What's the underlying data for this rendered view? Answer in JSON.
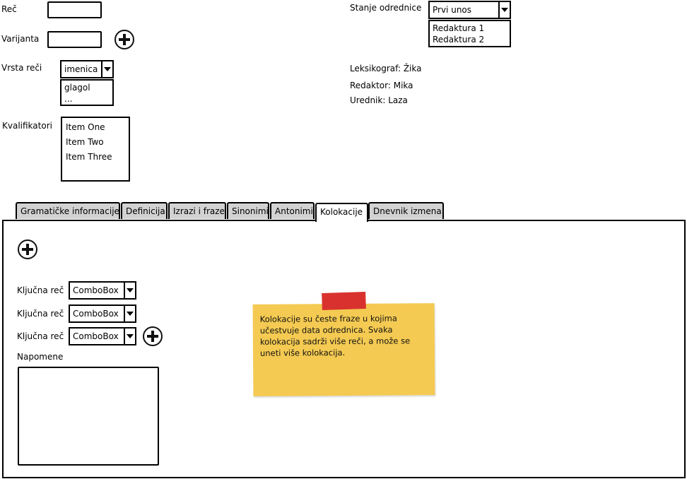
{
  "form": {
    "rec_label": "Reč",
    "varijanta_label": "Varijanta",
    "vrsta_reci_label": "Vrsta reči",
    "vrsta_reci_value": "imenica",
    "vrsta_reci_options": [
      "glagol",
      "..."
    ],
    "kvalifikatori_label": "Kvalifikatori",
    "kvalifikatori_items": [
      "Item One",
      "Item Two",
      "Item Three"
    ]
  },
  "status": {
    "label": "Stanje odrednice",
    "value": "Prvi unos",
    "options": [
      "Redaktura 1",
      "Redaktura 2"
    ]
  },
  "people": {
    "leksikograf": "Leksikograf: Žika",
    "redaktor": "Redaktor: Mika",
    "urednik": "Urednik: Laza"
  },
  "tabs": [
    {
      "label": "Gramatičke informacije"
    },
    {
      "label": "Definicija"
    },
    {
      "label": "Izrazi i fraze"
    },
    {
      "label": "Sinonimi"
    },
    {
      "label": "Antonimi"
    },
    {
      "label": "Kolokacije",
      "active": true
    },
    {
      "label": "Dnevnik izmena"
    }
  ],
  "kolokacije": {
    "rows": [
      {
        "label": "Ključna reč",
        "value": "ComboBox"
      },
      {
        "label": "Ključna reč",
        "value": "ComboBox"
      },
      {
        "label": "Ključna reč",
        "value": "ComboBox"
      }
    ],
    "napomene_label": "Napomene",
    "note": "Kolokacije su česte fraze u kojima učestvuje data odrednica. Svaka kolokacija sadrži više reči, a može se uneti više kolokacija."
  },
  "icons": {
    "add": "plus-circle-icon",
    "dropdown": "chevron-down-icon"
  },
  "colors": {
    "tab_inactive": "#d2d2d2",
    "sticky_note": "#f4ca52",
    "sticky_tape": "#d9322e"
  }
}
